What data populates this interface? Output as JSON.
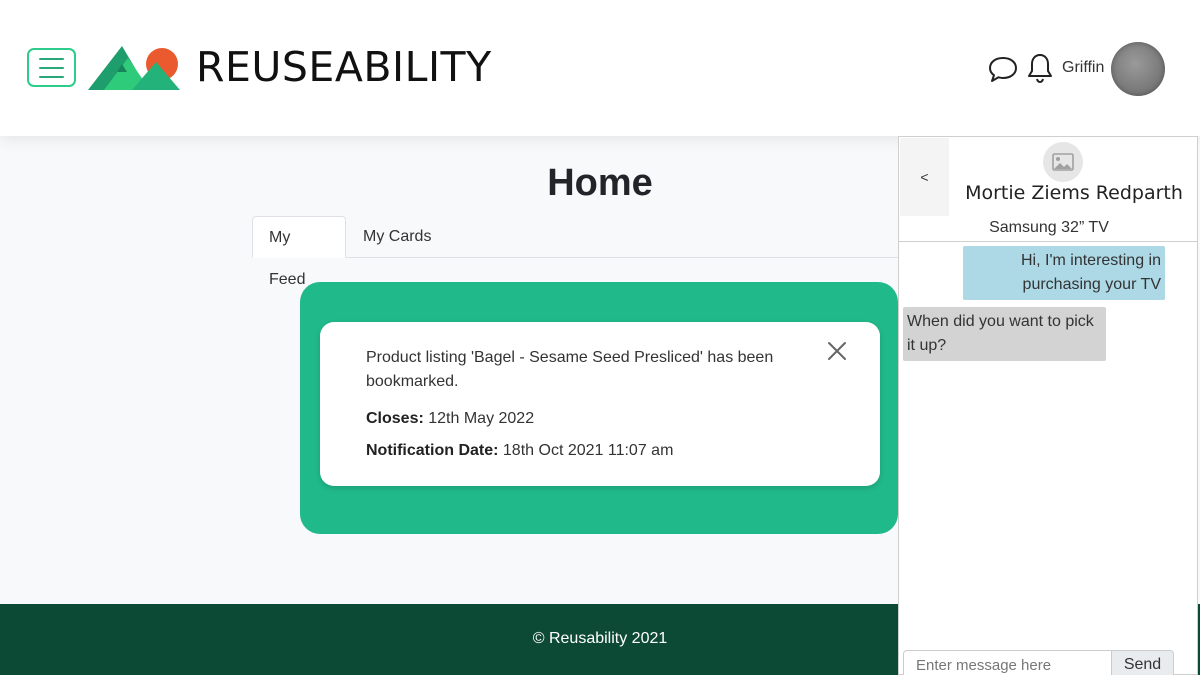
{
  "header": {
    "menu_icon": "hamburger-menu-icon",
    "brand": "REUSEABILITY",
    "chat_icon": "speech-bubble-icon",
    "bell_icon": "bell-icon",
    "username": "Griffin"
  },
  "main": {
    "title": "Home",
    "tabs": [
      {
        "label": "My Feed",
        "active": true
      },
      {
        "label": "My Cards",
        "active": false
      }
    ],
    "notification": {
      "message": "Product listing 'Bagel - Sesame Seed Presliced' has been bookmarked.",
      "closes_label": "Closes:",
      "closes_value": "12th May 2022",
      "date_label": "Notification Date:",
      "date_value": "18th Oct 2021 11:07 am"
    }
  },
  "footer": {
    "text": "© Reusability 2021"
  },
  "chat": {
    "back_label": "<",
    "contact_name": "Mortie Ziems Redparth",
    "product": "Samsung 32” TV",
    "messages": [
      {
        "direction": "outgoing",
        "text": "Hi, I'm interesting in purchasing your TV"
      },
      {
        "direction": "incoming",
        "text": "When did you want to pick it up?"
      }
    ],
    "input_placeholder": "Enter message here",
    "send_label": "Send"
  },
  "colors": {
    "brand_green": "#20b98a",
    "footer_green": "#0d4a36",
    "outgoing_bubble": "#add8e6",
    "incoming_bubble": "#d3d3d3"
  }
}
